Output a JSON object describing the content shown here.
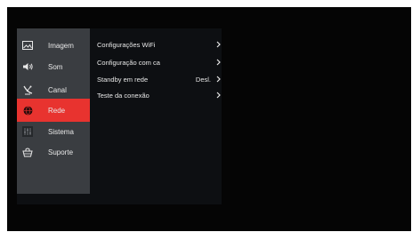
{
  "sidebar": {
    "items": [
      {
        "label": "Imagem",
        "icon": "picture-icon"
      },
      {
        "label": "Som",
        "icon": "speaker-icon"
      },
      {
        "label": "Canal",
        "icon": "satellite-icon"
      },
      {
        "label": "Rede",
        "icon": "globe-icon",
        "active": true
      },
      {
        "label": "Sistema",
        "icon": "sliders-icon"
      },
      {
        "label": "Suporte",
        "icon": "basket-icon"
      }
    ]
  },
  "network_menu": {
    "options": [
      {
        "label": "Configurações WiFi",
        "value": ""
      },
      {
        "label": "Configuração com ca",
        "value": ""
      },
      {
        "label": "Standby em rede",
        "value": "Desl."
      },
      {
        "label": "Teste da conexão",
        "value": ""
      }
    ]
  },
  "colors": {
    "accent": "#e8332f",
    "sidebar_bg": "#3a3d41",
    "panel_bg": "#0d0f12",
    "screen_bg": "#050505",
    "text": "#e8e8e8"
  }
}
